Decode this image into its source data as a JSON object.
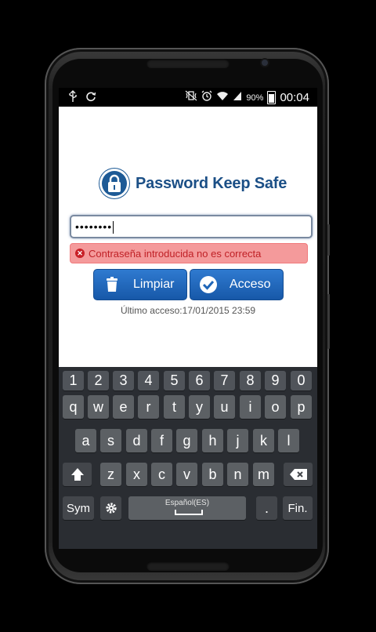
{
  "status_bar": {
    "battery_pct": "90%",
    "time": "00:04"
  },
  "app": {
    "title": "Password Keep Safe",
    "password_value": "••••••••",
    "error_message": "Contraseña introducida no es correcta",
    "clear_button": "Limpiar",
    "access_button": "Acceso",
    "last_access": "Último acceso:17/01/2015 23:59"
  },
  "keyboard": {
    "number_row": [
      "1",
      "2",
      "3",
      "4",
      "5",
      "6",
      "7",
      "8",
      "9",
      "0"
    ],
    "row1": [
      "q",
      "w",
      "e",
      "r",
      "t",
      "y",
      "u",
      "i",
      "o",
      "p"
    ],
    "row2": [
      "a",
      "s",
      "d",
      "f",
      "g",
      "h",
      "j",
      "k",
      "l"
    ],
    "row3": [
      "z",
      "x",
      "c",
      "v",
      "b",
      "n",
      "m"
    ],
    "sym_label": "Sym",
    "space_label": "Español(ES)",
    "period_label": ".",
    "enter_label": "Fin."
  },
  "colors": {
    "brand": "#1d5a96",
    "button": "#1f66b8",
    "error_bg": "#f49a9b",
    "error_text": "#c02026"
  }
}
